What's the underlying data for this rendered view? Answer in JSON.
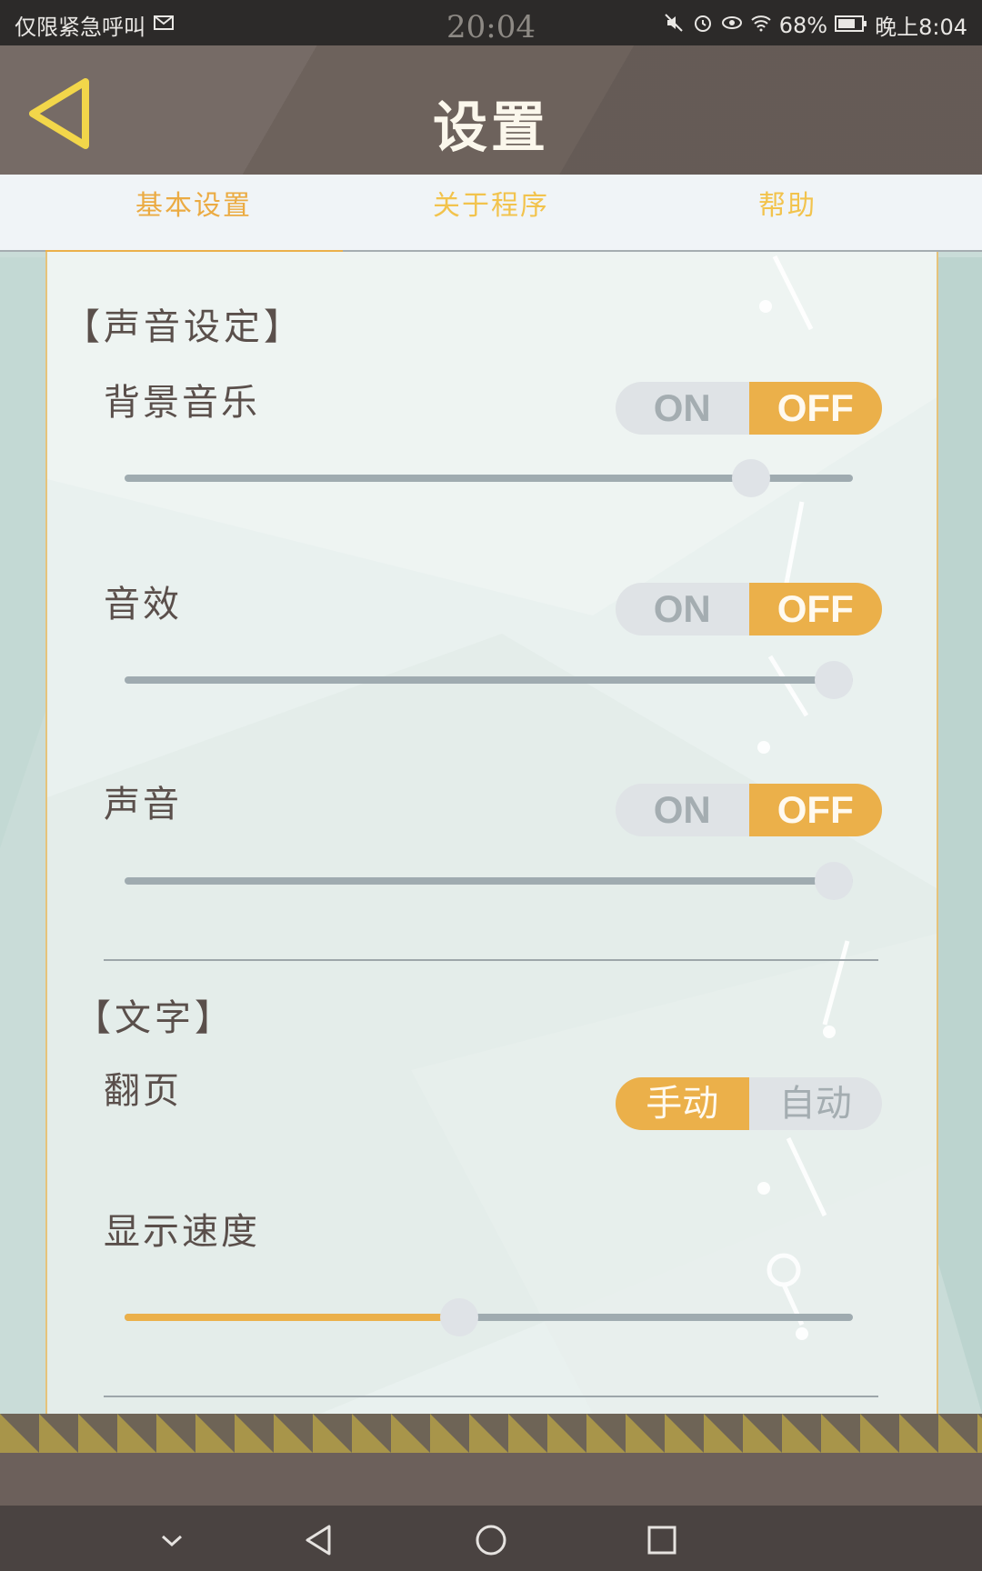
{
  "status_bar": {
    "carrier_text": "仅限紧急呼叫",
    "clock_center": "20:04",
    "battery": "68%",
    "time_right": "晚上8:04"
  },
  "header": {
    "title": "设置",
    "back_icon": "back-triangle-icon"
  },
  "tabs": [
    {
      "label": "基本设置",
      "active": true
    },
    {
      "label": "关于程序",
      "active": false
    },
    {
      "label": "帮助",
      "active": false
    }
  ],
  "sound_section": {
    "title": "【声音设定】",
    "rows": [
      {
        "label": "背景音乐",
        "on": "ON",
        "off": "OFF",
        "selected": "OFF",
        "level": 0.86
      },
      {
        "label": "音效",
        "on": "ON",
        "off": "OFF",
        "selected": "OFF",
        "level": 1.0
      },
      {
        "label": "声音",
        "on": "ON",
        "off": "OFF",
        "selected": "OFF",
        "level": 1.0
      }
    ]
  },
  "text_section": {
    "title": "【文字】",
    "page_turn": {
      "label": "翻页",
      "manual": "手动",
      "auto": "自动",
      "selected": "手动"
    },
    "display_speed": {
      "label": "显示速度",
      "level": 0.46
    }
  },
  "colors": {
    "accent": "#ebb04a",
    "header_bg": "#6d625c",
    "panel_bg": "#e9f1ef"
  },
  "nav": {
    "icons": [
      "chevron-down-icon",
      "back-icon",
      "home-icon",
      "recents-icon"
    ]
  }
}
